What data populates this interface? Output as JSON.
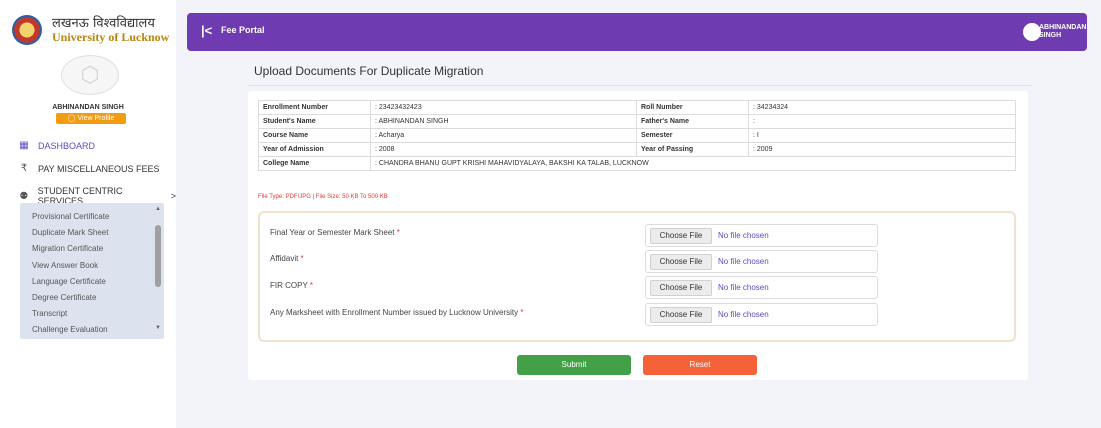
{
  "brand": {
    "hindi": "लखनऊ विश्वविद्यालय",
    "english": "University of Lucknow"
  },
  "sidebar": {
    "username": "ABHINANDAN SINGH",
    "view_profile": "View Profile",
    "nav": [
      {
        "label": "DASHBOARD",
        "icon": "grid-icon"
      },
      {
        "label": "PAY MISCELLANEOUS FEES",
        "icon": "rupee-icon"
      },
      {
        "label": "STUDENT CENTRIC SERVICES",
        "icon": "user-icon",
        "arrow": ">"
      }
    ],
    "submenu": [
      "Provisional Certificate",
      "Duplicate Mark Sheet",
      "Migration Certificate",
      "View Answer Book",
      "Language Certificate",
      "Degree Certificate",
      "Transcript",
      "Challenge Evaluation"
    ]
  },
  "topbar": {
    "title": "Fee Portal",
    "user_name": "ABHINANDAN SINGH",
    "collapse_glyph": "|<"
  },
  "main": {
    "title": "Upload Documents For Duplicate Migration"
  },
  "info": {
    "enrollment_label": "Enrollment Number",
    "enrollment_value": ": 23423432423",
    "roll_label": "Roll Number",
    "roll_value": ": 34234324",
    "student_label": "Student's Name",
    "student_value": ": ABHINANDAN SINGH",
    "father_label": "Father's Name",
    "father_value": ":",
    "course_label": "Course Name",
    "course_value": ": Acharya",
    "semester_label": "Semester",
    "semester_value": ": I",
    "admission_label": "Year of Admission",
    "admission_value": ": 2008",
    "passing_label": "Year of Passing",
    "passing_value": ": 2009",
    "college_label": "College Name",
    "college_value": ": CHANDRA BHANU GUPT KRISHI MAHAVIDYALAYA, BAKSHI KA TALAB, LUCKNOW"
  },
  "file_note": "File Type: PDF/JPG | File Size: 50 KB To 500 KB",
  "uploads": [
    {
      "label": "Final Year or Semester Mark Sheet",
      "required": "*",
      "button": "Choose File",
      "status": "No file chosen"
    },
    {
      "label": "Affidavit",
      "required": "*",
      "button": "Choose File",
      "status": "No file chosen"
    },
    {
      "label": "FIR COPY",
      "required": "*",
      "button": "Choose File",
      "status": "No file chosen"
    },
    {
      "label": "Any Marksheet with Enrollment Number issued by Lucknow University",
      "required": "*",
      "button": "Choose File",
      "status": "No file chosen"
    }
  ],
  "actions": {
    "submit": "Submit",
    "reset": "Reset"
  },
  "colors": {
    "topbar": "#6f3bb0",
    "submit": "#43a047",
    "reset": "#f4623a",
    "accent": "#5b4cc4"
  }
}
